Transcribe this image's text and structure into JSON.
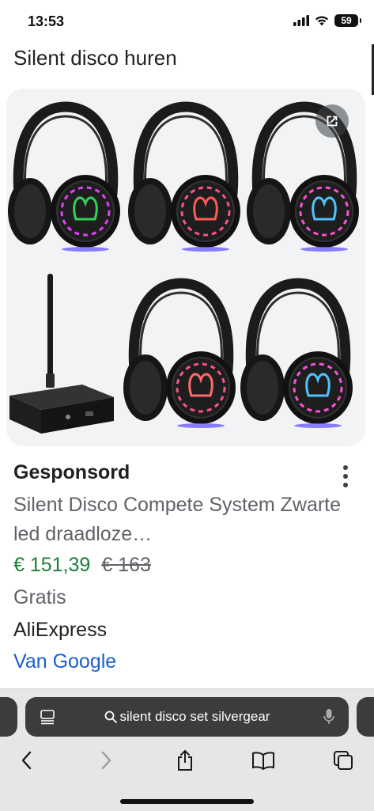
{
  "status_bar": {
    "time": "13:53",
    "battery": "59"
  },
  "page": {
    "title": "Silent disco huren"
  },
  "ad": {
    "sponsored_label": "Gesponsord",
    "title": "Silent Disco Compete System Zwarte led draadloze…",
    "price": "€ 151,39",
    "old_price": "€ 163",
    "shipping": "Gratis",
    "seller": "AliExpress",
    "source": "Van Google"
  },
  "browser": {
    "search_text": "silent disco set  silvergear"
  },
  "icons": {
    "expand": "open-in-new-icon",
    "more": "more-vert-icon",
    "tabs": "tab-overview-icon",
    "mic": "microphone-icon",
    "back": "chevron-left-icon",
    "forward": "chevron-right-icon",
    "share": "share-icon",
    "bookmarks": "book-icon",
    "tabs_switcher": "tabs-icon"
  },
  "colors": {
    "price": "#188038",
    "link": "#1a5fd0",
    "addressbar": "#3c3c3e"
  }
}
